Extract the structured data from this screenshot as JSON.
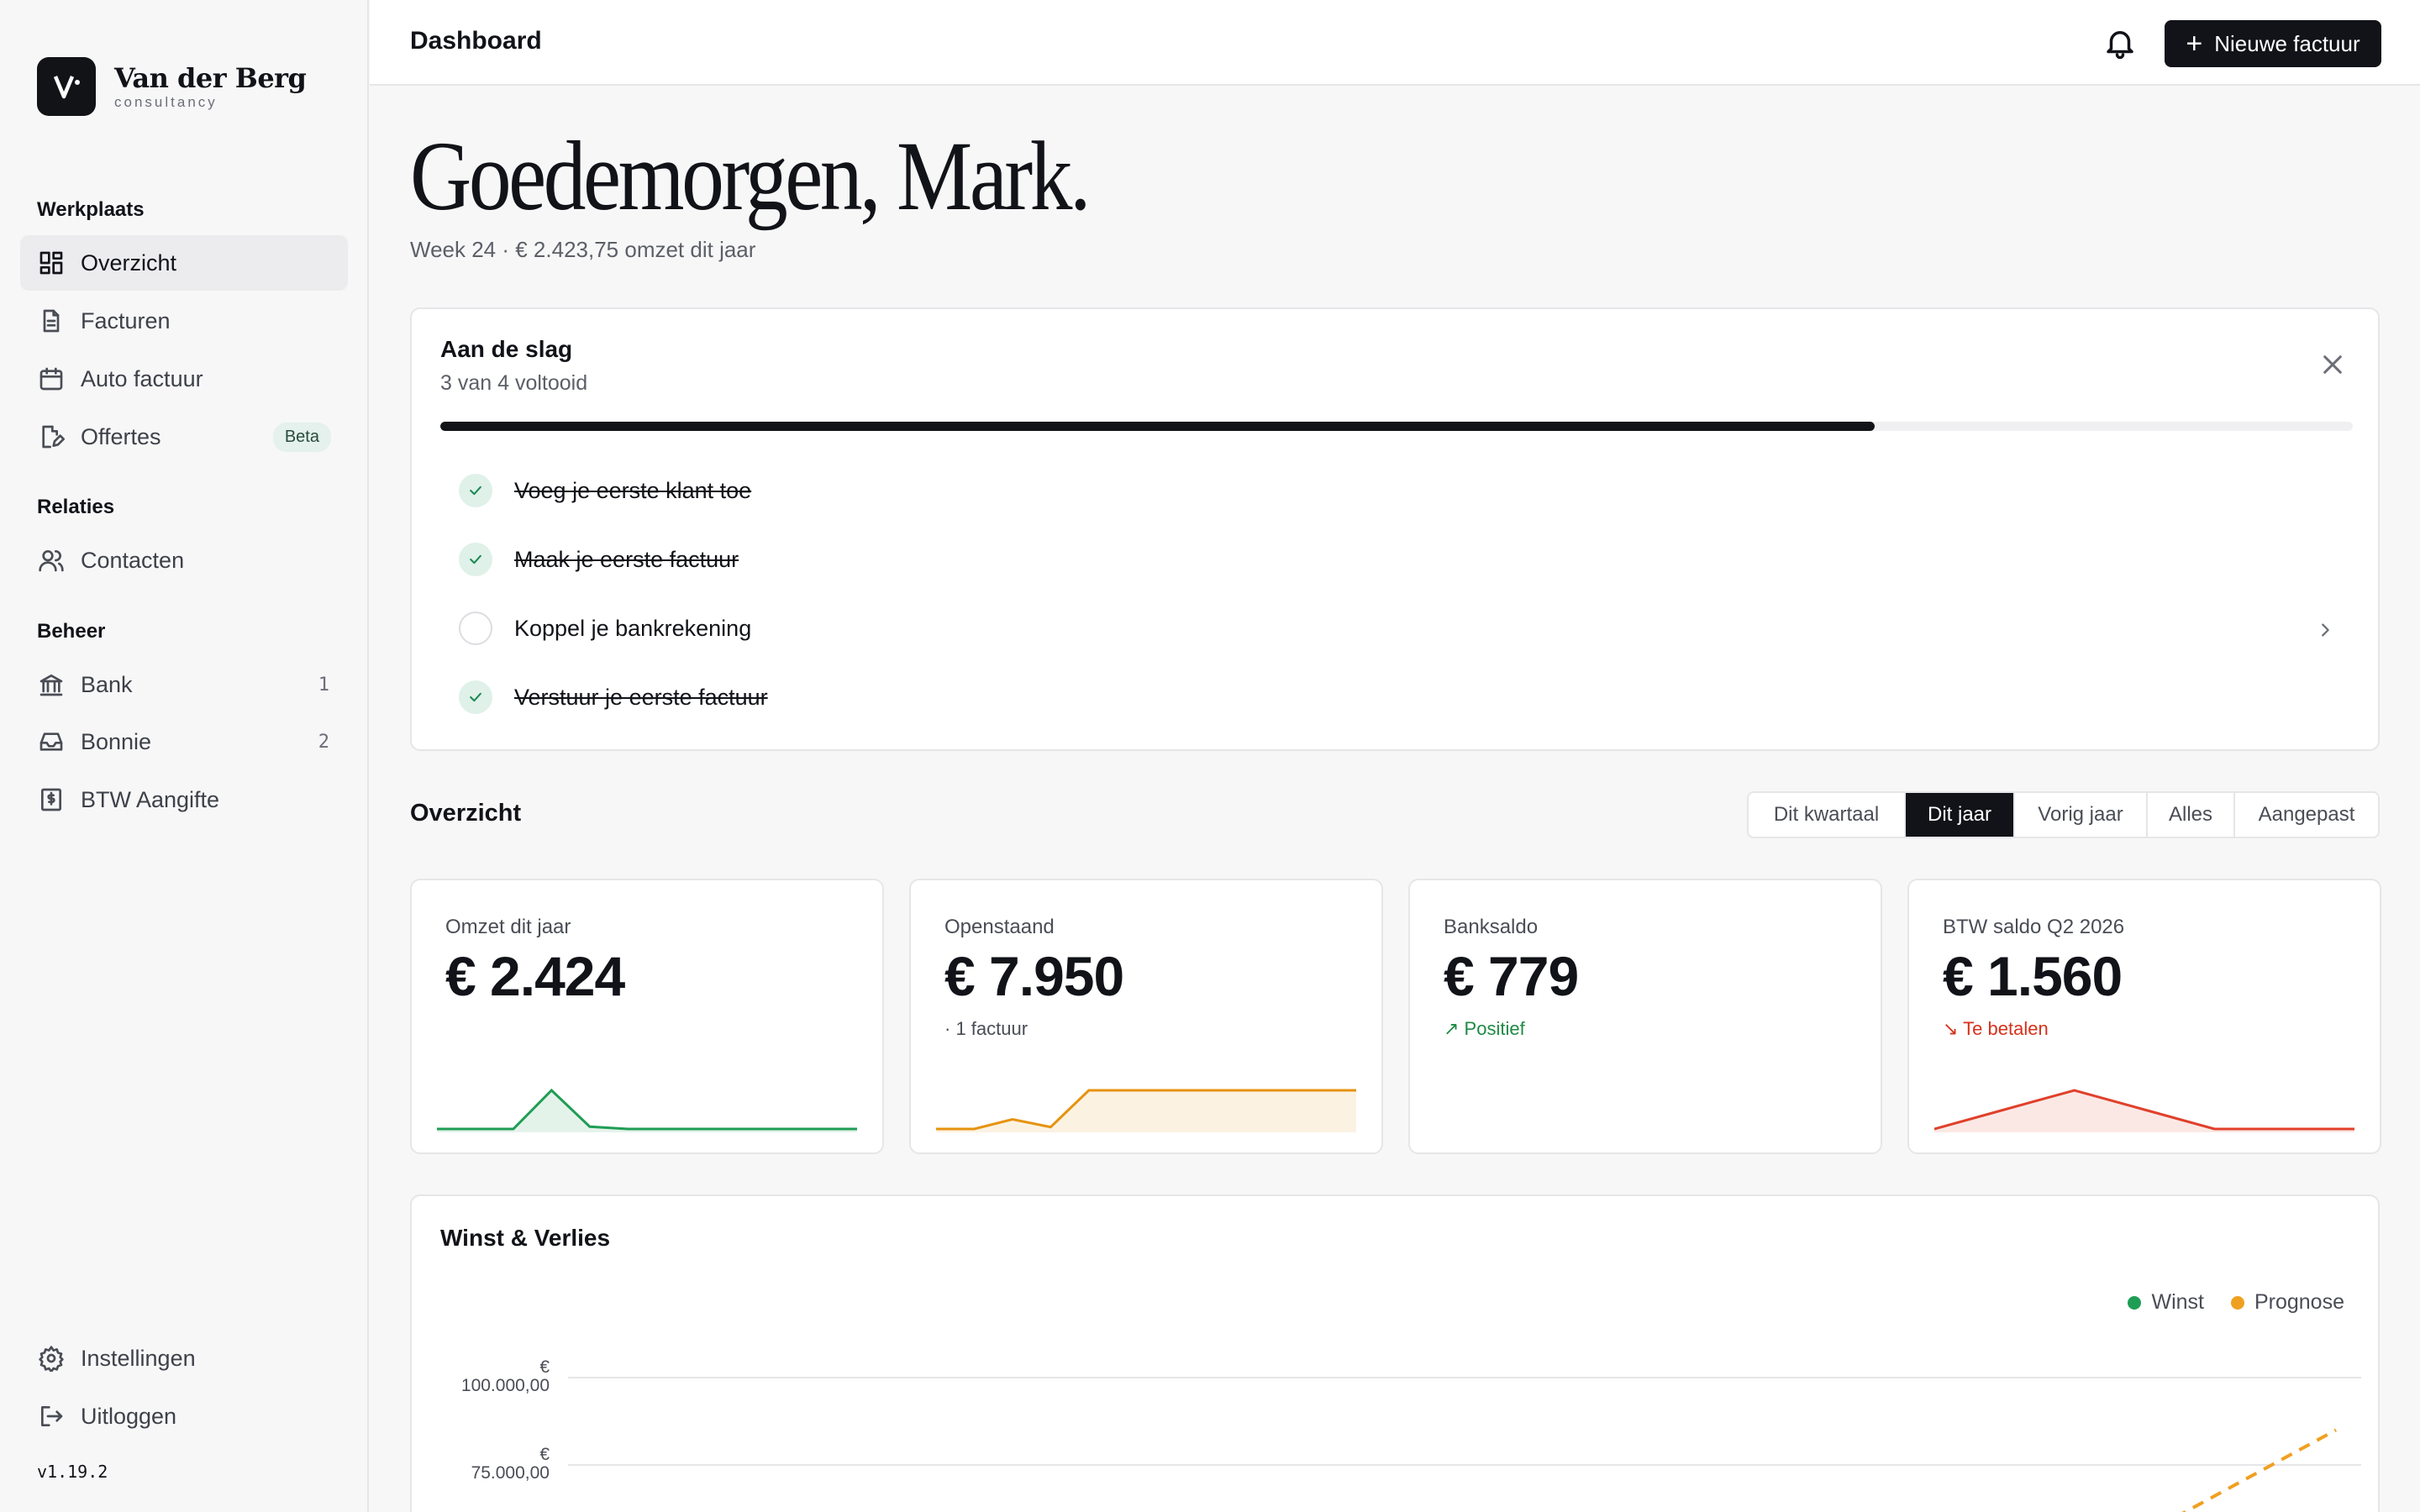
{
  "brand": {
    "name": "Van der Berg",
    "sub": "consultancy"
  },
  "sidebar": {
    "sections": [
      {
        "title": "Werkplaats"
      },
      {
        "title": "Relaties"
      },
      {
        "title": "Beheer"
      }
    ],
    "items": [
      {
        "label": "Overzicht",
        "icon": "grid-icon",
        "active": true
      },
      {
        "label": "Facturen",
        "icon": "document-icon"
      },
      {
        "label": "Auto factuur",
        "icon": "calendar-icon"
      },
      {
        "label": "Offertes",
        "icon": "edit-document-icon",
        "badge": "Beta"
      },
      {
        "label": "Contacten",
        "icon": "users-icon"
      },
      {
        "label": "Bank",
        "icon": "bank-icon",
        "count": "1"
      },
      {
        "label": "Bonnie",
        "icon": "inbox-icon",
        "count": "2"
      },
      {
        "label": "BTW Aangifte",
        "icon": "tax-icon"
      }
    ],
    "footer": [
      {
        "label": "Instellingen",
        "icon": "gear-icon"
      },
      {
        "label": "Uitloggen",
        "icon": "logout-icon"
      }
    ],
    "version": "v1.19.2"
  },
  "topbar": {
    "title": "Dashboard",
    "new_invoice": "Nieuwe factuur"
  },
  "greeting": {
    "title": "Goedemorgen, Mark.",
    "sub": "Week 24 · € 2.423,75 omzet dit jaar"
  },
  "onboarding": {
    "title": "Aan de slag",
    "sub": "3 van 4 voltooid",
    "progress": 0.75,
    "tasks": [
      {
        "label": "Voeg je eerste klant toe",
        "done": true
      },
      {
        "label": "Maak je eerste factuur",
        "done": true
      },
      {
        "label": "Koppel je bankrekening",
        "done": false
      },
      {
        "label": "Verstuur je eerste factuur",
        "done": true
      }
    ]
  },
  "overview": {
    "title": "Overzicht",
    "periods": [
      "Dit kwartaal",
      "Dit jaar",
      "Vorig jaar",
      "Alles",
      "Aangepast"
    ],
    "active_period": "Dit jaar",
    "kpis": [
      {
        "label": "Omzet dit jaar",
        "value": "€ 2.424",
        "note": "",
        "color": "#1f9d55",
        "spark": [
          0,
          0,
          0,
          1,
          0.06,
          0,
          0,
          0,
          0,
          0,
          0,
          0
        ]
      },
      {
        "label": "Openstaand",
        "value": "€ 7.950",
        "note": "· 1 factuur",
        "color": "#e6930f",
        "spark": [
          0,
          0,
          0.25,
          0.05,
          1,
          1,
          1,
          1,
          1,
          1,
          1,
          1
        ]
      },
      {
        "label": "Banksaldo",
        "value": "€ 779",
        "note": "↗ Positief",
        "color": "#1e8a46",
        "spark": []
      },
      {
        "label": "BTW saldo Q2 2026",
        "value": "€ 1.560",
        "note": "↘ Te betalen",
        "color": "#e0402b",
        "spark": [
          0,
          0.5,
          1,
          0.5,
          0,
          0,
          0
        ]
      }
    ]
  },
  "chart_data": {
    "type": "line",
    "title": "Winst & Verlies",
    "series": [
      {
        "name": "Winst",
        "color": "#1f9d55",
        "values": []
      },
      {
        "name": "Prognose",
        "color": "#f0a020",
        "values": [
          null,
          null,
          null,
          null,
          null,
          null,
          null,
          null,
          null,
          null,
          60000,
          85000
        ]
      }
    ],
    "y_ticks": [
      "€ 100.000,00",
      "€ 75.000,00"
    ],
    "ylim": [
      50000,
      100000
    ],
    "grid": true,
    "legend": "top-right"
  }
}
